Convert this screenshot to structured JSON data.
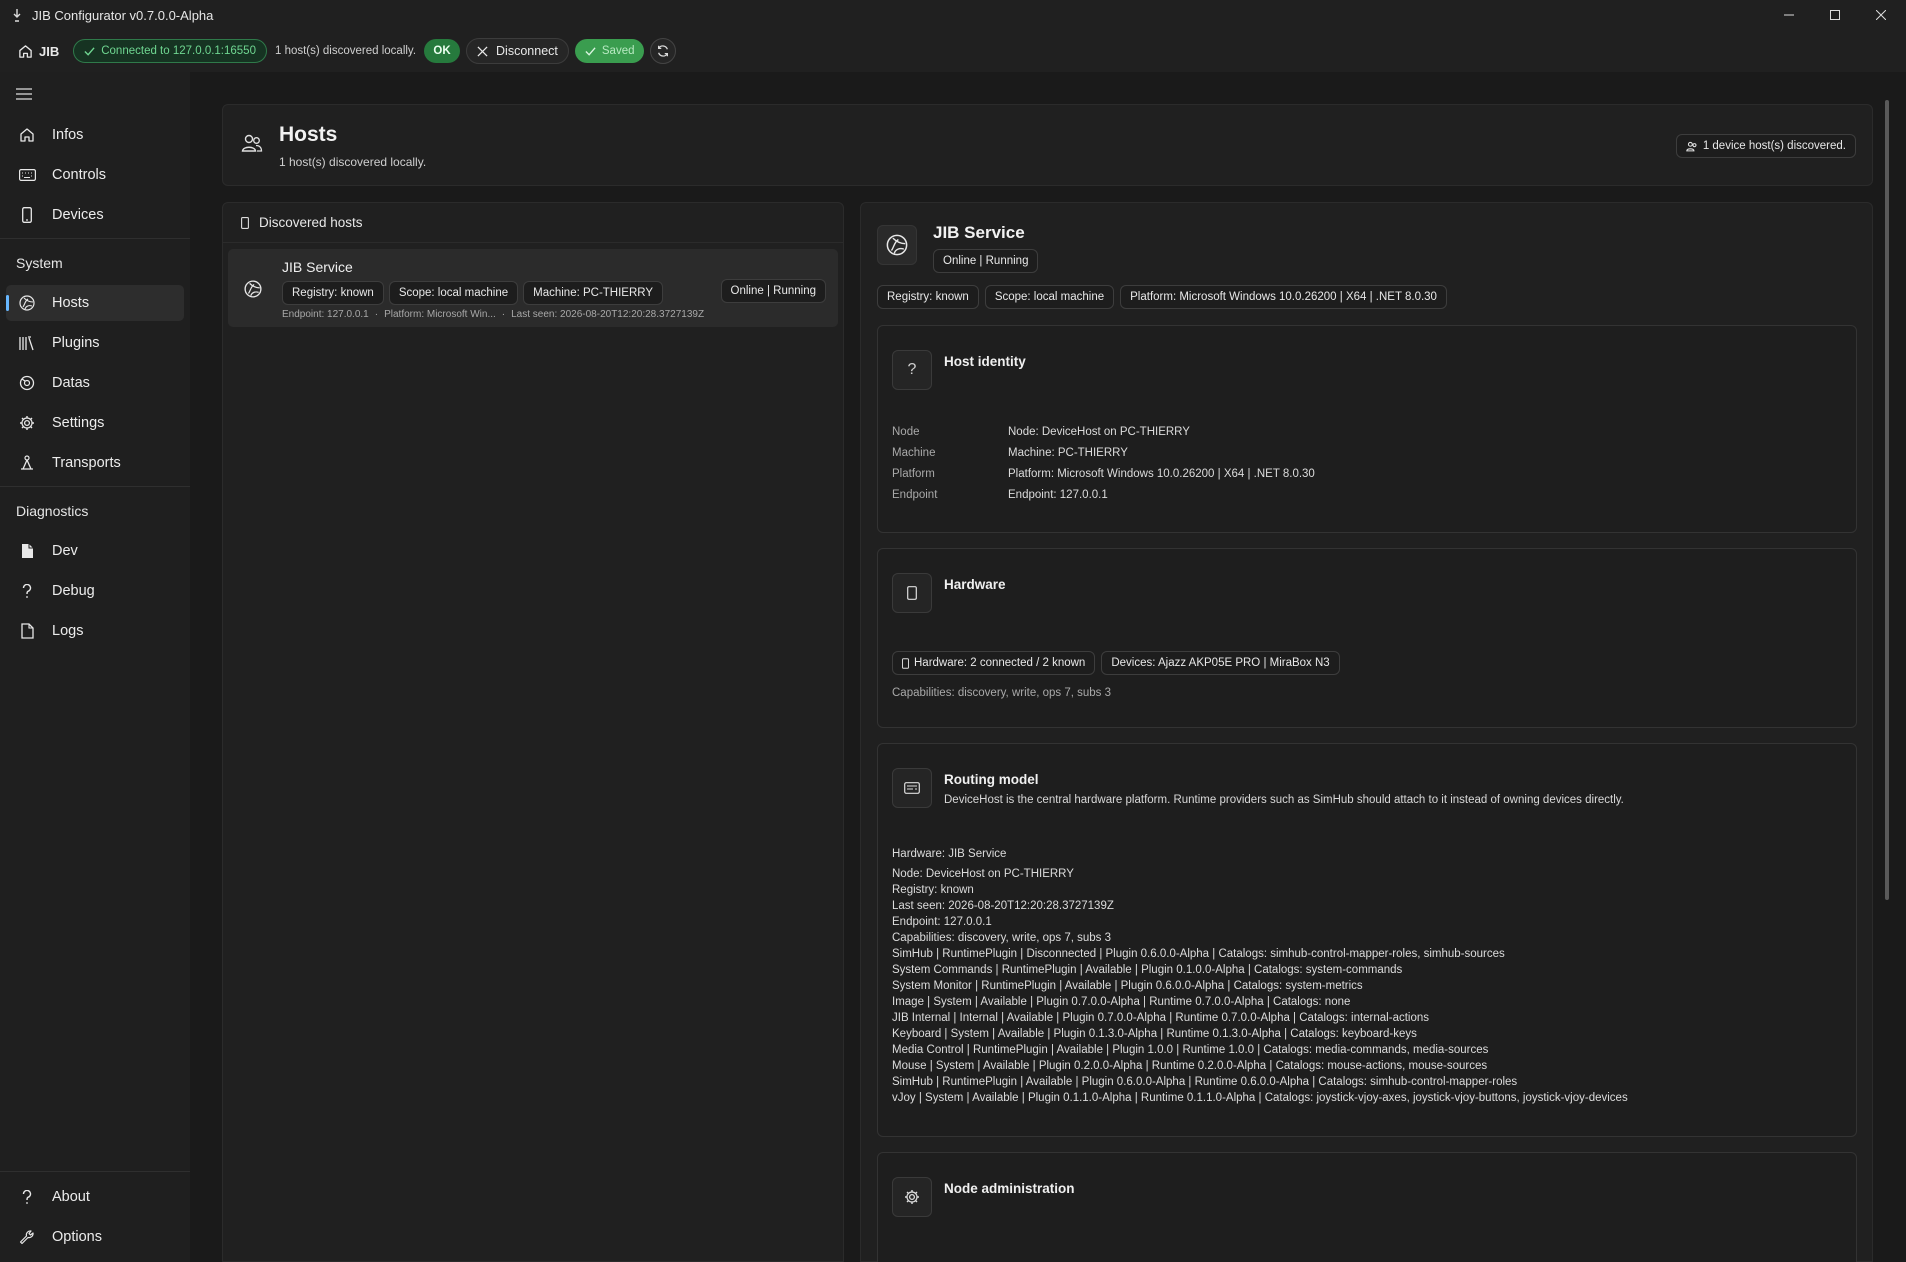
{
  "window": {
    "title": "JIB Configurator v0.7.0.0-Alpha"
  },
  "toolbar": {
    "home_label": "JIB",
    "connection": "Connected to 127.0.0.1:16550",
    "hosts_discovered": "1 host(s) discovered locally.",
    "ok_label": "OK",
    "disconnect_label": "Disconnect",
    "saved_label": "Saved"
  },
  "sidebar": {
    "top_items": [
      {
        "label": "Infos",
        "icon": "home-icon"
      },
      {
        "label": "Controls",
        "icon": "keyboard-icon"
      },
      {
        "label": "Devices",
        "icon": "device-icon"
      }
    ],
    "system_heading": "System",
    "system_items": [
      {
        "label": "Hosts",
        "icon": "globe-icon",
        "active": true
      },
      {
        "label": "Plugins",
        "icon": "library-icon"
      },
      {
        "label": "Datas",
        "icon": "data-icon"
      },
      {
        "label": "Settings",
        "icon": "gear-icon"
      },
      {
        "label": "Transports",
        "icon": "transport-icon"
      }
    ],
    "diagnostics_heading": "Diagnostics",
    "diagnostics_items": [
      {
        "label": "Dev",
        "icon": "file-icon"
      },
      {
        "label": "Debug",
        "icon": "question-icon"
      },
      {
        "label": "Logs",
        "icon": "document-icon"
      }
    ],
    "bottom_items": [
      {
        "label": "About",
        "icon": "question-icon"
      },
      {
        "label": "Options",
        "icon": "wrench-icon"
      }
    ]
  },
  "header": {
    "title": "Hosts",
    "subtitle": "1 host(s) discovered locally.",
    "badge": "1 device host(s) discovered."
  },
  "hosts_panel": {
    "title": "Discovered hosts",
    "host": {
      "name": "JIB Service",
      "registry": "Registry: known",
      "scope": "Scope: local machine",
      "machine": "Machine: PC-THIERRY",
      "status": "Online | Running",
      "endpoint": "Endpoint: 127.0.0.1",
      "platform": "Platform: Microsoft Win...",
      "last_seen": "Last seen: 2026-08-20T12:20:28.3727139Z"
    }
  },
  "detail": {
    "title": "JIB Service",
    "state": "Online | Running",
    "registry": "Registry: known",
    "scope": "Scope: local machine",
    "platform": "Platform: Microsoft Windows 10.0.26200 | X64 | .NET 8.0.30",
    "identity": {
      "title": "Host identity",
      "rows": [
        {
          "key": "Node",
          "value": "Node: DeviceHost on PC-THIERRY"
        },
        {
          "key": "Machine",
          "value": "Machine: PC-THIERRY"
        },
        {
          "key": "Platform",
          "value": "Platform: Microsoft Windows 10.0.26200 | X64 | .NET 8.0.30"
        },
        {
          "key": "Endpoint",
          "value": "Endpoint: 127.0.0.1"
        }
      ]
    },
    "hardware": {
      "title": "Hardware",
      "summary": "Hardware: 2 connected / 2 known",
      "devices": "Devices: Ajazz AKP05E PRO  |  MiraBox N3",
      "capabilities": "Capabilities: discovery, write, ops 7, subs 3"
    },
    "routing": {
      "title": "Routing model",
      "description": "DeviceHost is the central hardware platform. Runtime providers such as SimHub should attach to it instead of owning devices directly.",
      "header_line": "Hardware: JIB Service",
      "info_lines": [
        "Node: DeviceHost on PC-THIERRY",
        "Registry: known",
        "Last seen: 2026-08-20T12:20:28.3727139Z",
        "Endpoint: 127.0.0.1",
        "Capabilities: discovery, write, ops 7, subs 3"
      ],
      "plugin_lines": [
        "SimHub | RuntimePlugin | Disconnected | Plugin 0.6.0.0-Alpha | Catalogs: simhub-control-mapper-roles, simhub-sources",
        "System Commands | RuntimePlugin | Available | Plugin 0.1.0.0-Alpha | Catalogs: system-commands",
        "System Monitor | RuntimePlugin | Available | Plugin 0.6.0.0-Alpha | Catalogs: system-metrics",
        "Image | System | Available | Plugin 0.7.0.0-Alpha | Runtime 0.7.0.0-Alpha | Catalogs: none",
        "JIB Internal | Internal | Available | Plugin 0.7.0.0-Alpha | Runtime 0.7.0.0-Alpha | Catalogs: internal-actions",
        "Keyboard | System | Available | Plugin 0.1.3.0-Alpha | Runtime 0.1.3.0-Alpha | Catalogs: keyboard-keys",
        "Media Control | RuntimePlugin | Available | Plugin 1.0.0 | Runtime 1.0.0 | Catalogs: media-commands, media-sources",
        "Mouse | System | Available | Plugin 0.2.0.0-Alpha | Runtime 0.2.0.0-Alpha | Catalogs: mouse-actions, mouse-sources",
        "SimHub | RuntimePlugin | Available | Plugin 0.6.0.0-Alpha | Runtime 0.6.0.0-Alpha | Catalogs: simhub-control-mapper-roles",
        "vJoy | System | Available | Plugin 0.1.1.0-Alpha | Runtime 0.1.1.0-Alpha | Catalogs: joystick-vjoy-axes, joystick-vjoy-buttons, joystick-vjoy-devices"
      ]
    },
    "admin": {
      "title": "Node administration"
    }
  },
  "colors": {
    "accent": "#67b7ff",
    "ok_green": "#267a3d",
    "connected_text": "#6fd691",
    "background": "#1a1a1a"
  }
}
